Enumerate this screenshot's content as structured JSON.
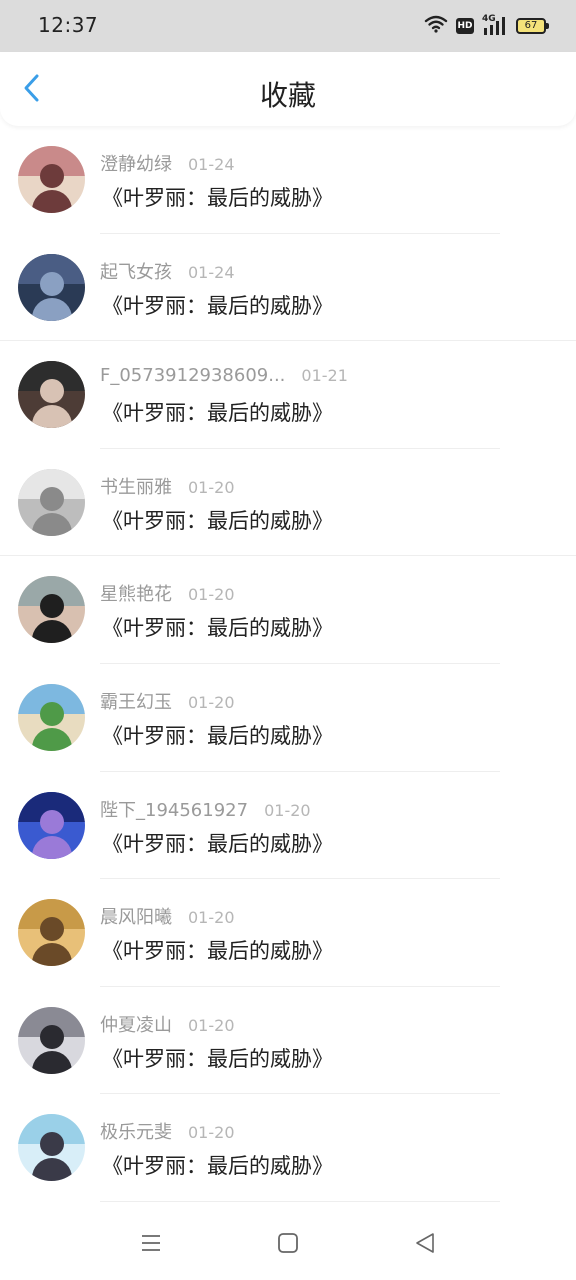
{
  "status_bar": {
    "time": "12:37",
    "hd_label": "HD",
    "network_label": "4G",
    "battery_level": "67"
  },
  "header": {
    "title": "收藏",
    "back_icon": "chevron-left-icon",
    "accent_color": "#3a9ee8"
  },
  "favorites": [
    {
      "user": "澄静幼绿",
      "date": "01-24",
      "title": "《叶罗丽：最后的威胁》",
      "avatar_colors": [
        "#c98a8a",
        "#6d3b3b",
        "#e9d6c6"
      ]
    },
    {
      "user": "起飞女孩",
      "date": "01-24",
      "title": "《叶罗丽：最后的威胁》",
      "avatar_colors": [
        "#4a5d84",
        "#8aa0c2",
        "#2a3a55"
      ]
    },
    {
      "user": "F_0573912938609...",
      "date": "01-21",
      "title": "《叶罗丽：最后的威胁》",
      "avatar_colors": [
        "#2d2d2d",
        "#d8c2b4",
        "#4d3c36"
      ]
    },
    {
      "user": "书生丽雅",
      "date": "01-20",
      "title": "《叶罗丽：最后的威胁》",
      "avatar_colors": [
        "#e6e6e6",
        "#8a8a8a",
        "#bdbdbd"
      ]
    },
    {
      "user": "星熊艳花",
      "date": "01-20",
      "title": "《叶罗丽：最后的威胁》",
      "avatar_colors": [
        "#9aa8a8",
        "#1f1f1f",
        "#d8c0b0"
      ]
    },
    {
      "user": "霸王幻玉",
      "date": "01-20",
      "title": "《叶罗丽：最后的威胁》",
      "avatar_colors": [
        "#7db8e0",
        "#4f9a48",
        "#e8dcc0"
      ]
    },
    {
      "user": "陛下_194561927",
      "date": "01-20",
      "title": "《叶罗丽：最后的威胁》",
      "avatar_colors": [
        "#1a2a7a",
        "#9a7ad8",
        "#3a5ad0"
      ]
    },
    {
      "user": "晨风阳曦",
      "date": "01-20",
      "title": "《叶罗丽：最后的威胁》",
      "avatar_colors": [
        "#c89a48",
        "#6a4a28",
        "#e8c078"
      ]
    },
    {
      "user": "仲夏凌山",
      "date": "01-20",
      "title": "《叶罗丽：最后的威胁》",
      "avatar_colors": [
        "#8a8a94",
        "#2a2a30",
        "#d8d8de"
      ]
    },
    {
      "user": "极乐元斐",
      "date": "01-20",
      "title": "《叶罗丽：最后的威胁》",
      "avatar_colors": [
        "#9ad0e8",
        "#3a3a48",
        "#d8eef8"
      ]
    }
  ],
  "nav_bar": {
    "menu_icon": "menu-icon",
    "home_icon": "home-square-icon",
    "back_icon": "back-triangle-icon"
  }
}
